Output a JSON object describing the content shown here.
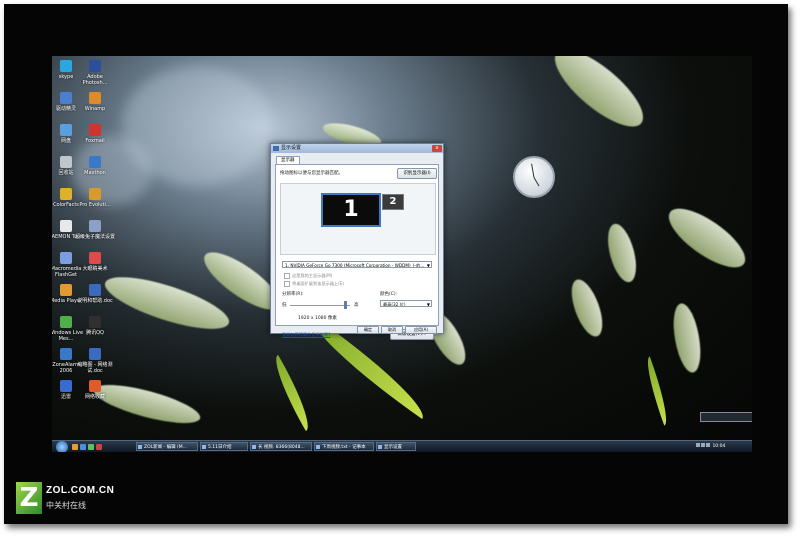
{
  "desktop_icons": [
    {
      "label": "skype",
      "color": "#2aa7e0"
    },
    {
      "label": "Adobe Photosh...",
      "color": "#2b4f9a"
    },
    {
      "label": "驱动精灵",
      "color": "#4a7fd0"
    },
    {
      "label": "Winamp",
      "color": "#e08a2a"
    },
    {
      "label": "网盘",
      "color": "#5aa0e0"
    },
    {
      "label": "Foxmail",
      "color": "#d0342c"
    },
    {
      "label": "回收站",
      "color": "#c0c6cc"
    },
    {
      "label": "Maxthon",
      "color": "#3a78c8"
    },
    {
      "label": "ColorFacts",
      "color": "#e0b02a"
    },
    {
      "label": "Pro Evoluti...",
      "color": "#d89a2a"
    },
    {
      "label": "DAEMON Tools",
      "color": "#e8e8e8"
    },
    {
      "label": "超级兔子魔法设置",
      "color": "#8aa0c8"
    },
    {
      "label": "Macromedia FlashGet",
      "color": "#7a9ee0"
    },
    {
      "label": "大眼睛美术",
      "color": "#e04a4a"
    },
    {
      "label": "Media Player",
      "color": "#e09a30"
    },
    {
      "label": "说明和帮助.doc",
      "color": "#3a6bc0"
    },
    {
      "label": "Windows Live Mes...",
      "color": "#4fb04a"
    },
    {
      "label": "腾讯QQ",
      "color": "#303030"
    },
    {
      "label": "ZoneAlarm 2006",
      "color": "#3a78c8"
    },
    {
      "label": "缩略图 - 网络测试.doc",
      "color": "#3a6bc0"
    },
    {
      "label": "迅雷",
      "color": "#3a6bd0"
    },
    {
      "label": "网络收藏",
      "color": "#e05a2a"
    }
  ],
  "dialog": {
    "title": "显示设置",
    "close": "x",
    "tab": "显示器",
    "instruction": "拖动图标以便与您显示器匹配。",
    "identify_button": "识别显示器(I)",
    "monitor_1": "1",
    "monitor_2": "2",
    "display_select": "1. NVIDIA GeForce Go 7300 (Microsoft Corporation - WDDM) 上的...",
    "checkbox_main": "这是我的主显示器(M)",
    "checkbox_extend": "将桌面扩展到该显示器上(E)",
    "resolution_label": "分辨率(R):",
    "low": "低",
    "high": "高",
    "resolution_value_fraction": 0.92,
    "resolution_text": "1920 x 1080 像素",
    "color_label": "颜色(C):",
    "color_select": "最高(32 位)",
    "help_link": "我如何获得最佳显示效果?",
    "advanced_button": "高级设置(V)...",
    "ok": "确定",
    "cancel": "取消",
    "apply": "应用(A)"
  },
  "taskbar": {
    "quick_launch_colors": [
      "#e0a030",
      "#4a90e0",
      "#60c060",
      "#d04040"
    ],
    "buttons": [
      {
        "label": "ZOL新闻 - 编辑 (M..."
      },
      {
        "label": "5.11日介绍"
      },
      {
        "label": "长 视频. 8366(8048..."
      },
      {
        "label": "下周视频.txt - 记事本"
      },
      {
        "label": "显示设置"
      }
    ],
    "clock": "10:04"
  },
  "watermark": {
    "logo_letter": "Z",
    "brand": "ZOL.COM.CN",
    "subtitle": "中关村在线"
  }
}
